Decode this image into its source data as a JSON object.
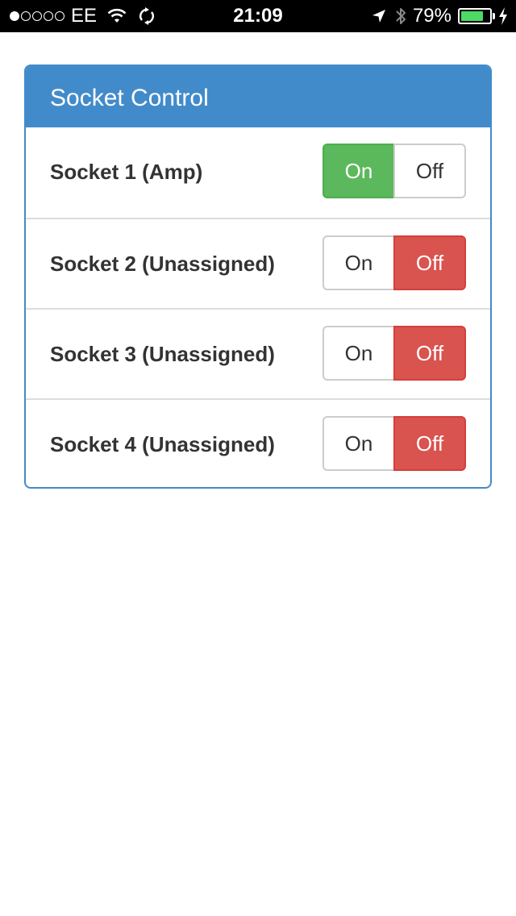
{
  "status_bar": {
    "signal_filled": 1,
    "signal_total": 5,
    "carrier": "EE",
    "wifi_icon": "wifi-icon",
    "sync_icon": "sync-icon",
    "time": "21:09",
    "location_icon": "location-arrow-icon",
    "bluetooth_icon": "bluetooth-icon",
    "battery_percent": "79%",
    "battery_level": 0.79,
    "charging_icon": "charging-bolt-icon"
  },
  "panel": {
    "title": "Socket Control",
    "accent_color": "#428bca",
    "on_color": "#5cb85c",
    "off_color": "#d9534f",
    "sockets": [
      {
        "label": "Socket 1 (Amp)",
        "on_label": "On",
        "off_label": "Off",
        "state": "on"
      },
      {
        "label": "Socket 2 (Unassigned)",
        "on_label": "On",
        "off_label": "Off",
        "state": "off"
      },
      {
        "label": "Socket 3 (Unassigned)",
        "on_label": "On",
        "off_label": "Off",
        "state": "off"
      },
      {
        "label": "Socket 4 (Unassigned)",
        "on_label": "On",
        "off_label": "Off",
        "state": "off"
      }
    ]
  }
}
